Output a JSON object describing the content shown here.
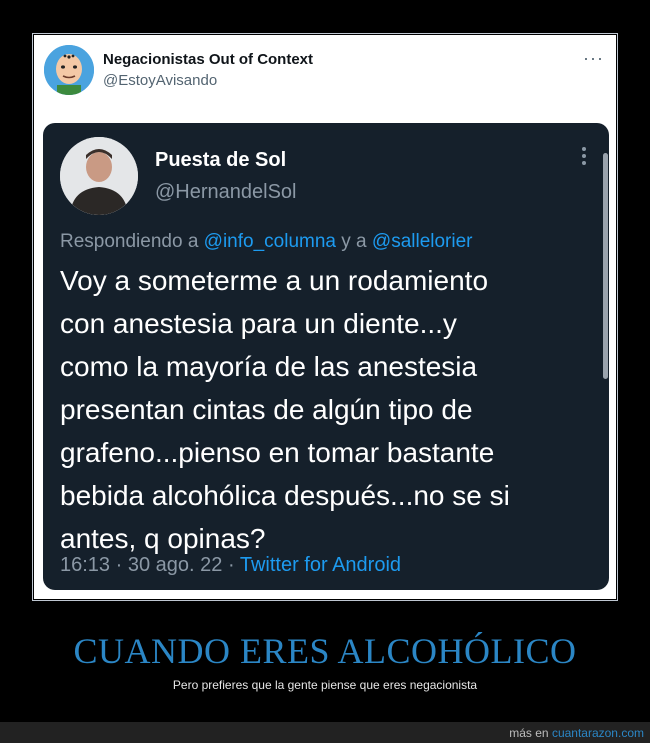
{
  "outer_tweet": {
    "display_name": "Negacionistas Out of Context",
    "handle": "@EstoyAvisando",
    "more_icon": "ellipsis-horizontal-icon",
    "more_glyph": "···"
  },
  "quoted_tweet": {
    "display_name": "Puesta de Sol",
    "handle": "@HernandelSol",
    "more_icon": "ellipsis-vertical-icon",
    "reply_prefix": "Respondiendo a",
    "reply_mention_1": "@info_columna",
    "reply_joiner": "y a",
    "reply_mention_2": "@sallelorier",
    "text": "Voy a someterme a un rodamiento\ncon anestesia  para un diente...y\ncomo la mayoría  de las anestesia\npresentan cintas de algún tipo de\ngrafeno...pienso en tomar bastante\nbebida alcohólica después...no se si\nantes, q opinas?",
    "time": "16:13",
    "separator": "·",
    "date": "30 ago. 22",
    "source": "Twitter for Android"
  },
  "caption": {
    "headline": "CUANDO ERES ALCOHÓLICO",
    "subline": "Pero prefieres que la gente piense que eres negacionista"
  },
  "footer": {
    "prefix": "más en",
    "link": "cuantarazon.com"
  },
  "colors": {
    "accent_blue": "#1d9bf0",
    "headline_blue": "#2b86c5",
    "dark_card": "#15202b"
  }
}
